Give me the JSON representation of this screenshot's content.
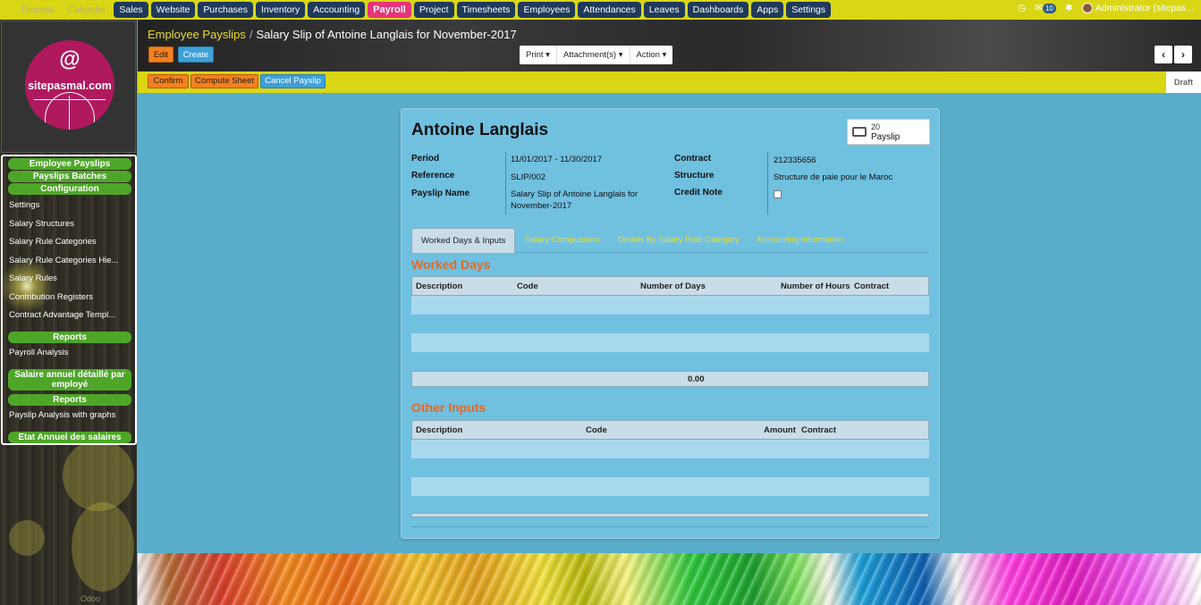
{
  "top_menu": {
    "items": [
      {
        "label": "Discuss",
        "faint": true
      },
      {
        "label": "Calendar",
        "faint": true
      },
      {
        "label": "Sales"
      },
      {
        "label": "Website"
      },
      {
        "label": "Purchases"
      },
      {
        "label": "Inventory"
      },
      {
        "label": "Accounting"
      },
      {
        "label": "Payroll",
        "active": true
      },
      {
        "label": "Project"
      },
      {
        "label": "Timesheets"
      },
      {
        "label": "Employees"
      },
      {
        "label": "Attendances"
      },
      {
        "label": "Leaves"
      },
      {
        "label": "Dashboards"
      },
      {
        "label": "Apps"
      },
      {
        "label": "Settings"
      }
    ],
    "message_count": "10",
    "user_label": "Administrator (sitepas..."
  },
  "logo": {
    "symbol": "@",
    "text": "sitepasmal.com"
  },
  "sidebar": {
    "sections": {
      "employee_payslips": "Employee Payslips",
      "payslips_batches": "Payslips Batches",
      "configuration": "Configuration",
      "reports": "Reports",
      "salaire": "Salaire annuel détaillé par employé",
      "reports2": "Reports",
      "etat": "Etat Annuel des salaires"
    },
    "config_items": [
      "Settings",
      "Salary Structures",
      "Salary Rule Categories",
      "Salary Rule Categories Hie...",
      "Salary Rules",
      "Contribution Registers",
      "Contract Advantage Templ..."
    ],
    "report_items": [
      "Payroll Analysis"
    ],
    "report2_items": [
      "Payslip Analysis with graphs"
    ],
    "footer": "Odoo"
  },
  "header": {
    "breadcrumb_parent": "Employee Payslips",
    "breadcrumb_sep": "/",
    "breadcrumb_current": "Salary Slip of Antoine Langlais for November-2017",
    "edit_label": "Edit",
    "create_label": "Create",
    "print_label": "Print ▾",
    "attachments_label": "Attachment(s) ▾",
    "action_label": "Action ▾",
    "prev_label": "‹",
    "next_label": "›"
  },
  "statusbar": {
    "confirm_label": "Confirm",
    "compute_label": "Compute Sheet",
    "cancel_label": "Cancel Payslip",
    "state": "Draft"
  },
  "form": {
    "employee_name": "Antoine Langlais",
    "stat_count": "20",
    "stat_label": "Payslip",
    "fields": {
      "period_label": "Period",
      "period_value": "11/01/2017 - 11/30/2017",
      "reference_label": "Reference",
      "reference_value": "SLIP/002",
      "payslip_name_label": "Payslip Name",
      "payslip_name_value": "Salary Slip of Antoine Langlais for November-2017",
      "contract_label": "Contract",
      "contract_value": "212335656",
      "structure_label": "Structure",
      "structure_value": "Structure de paie pour le Maroc",
      "credit_note_label": "Credit Note"
    },
    "tabs": [
      "Worked Days & Inputs",
      "Salary Computation",
      "Details By Salary Rule Category",
      "Accounting Information"
    ],
    "worked_days": {
      "title": "Worked Days",
      "columns": [
        "Description",
        "Code",
        "Number of Days",
        "Number of Hours",
        "Contract"
      ],
      "total": "0.00"
    },
    "other_inputs": {
      "title": "Other Inputs",
      "columns": [
        "Description",
        "Code",
        "Amount",
        "Contract"
      ]
    }
  }
}
